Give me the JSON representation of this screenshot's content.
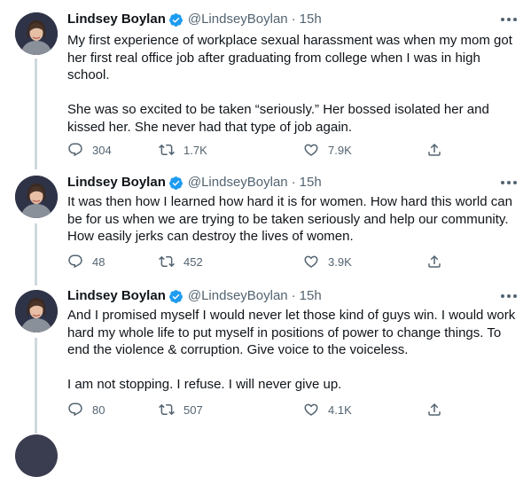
{
  "author": {
    "name": "Lindsey Boylan",
    "handle": "@LindseyBoylan",
    "separator": "·"
  },
  "colors": {
    "verified": "#1d9bf0",
    "text": "#0f1419",
    "muted": "#536471",
    "thread_line": "#cfd9de"
  },
  "tweets": [
    {
      "time": "15h",
      "paragraphs": [
        "My first experience of workplace sexual harassment was when my mom got her first real office job after graduating from college when I was in high school.",
        "She was so excited to be taken “seriously.” Her bossed isolated her and kissed her. She never had that type of job again."
      ],
      "replies": "304",
      "retweets": "1.7K",
      "likes": "7.9K"
    },
    {
      "time": "15h",
      "paragraphs": [
        "It was then how I learned how hard it is for women. How hard this world can be for us when we are trying to be taken seriously and help our community. How easily jerks can destroy the lives of women."
      ],
      "replies": "48",
      "retweets": "452",
      "likes": "3.9K"
    },
    {
      "time": "15h",
      "paragraphs": [
        "And I promised myself I would never let those kind of guys win. I would work hard my whole life to put myself in positions of power to change things. To end the violence & corruption. Give voice to the voiceless.",
        "I am not stopping. I refuse. I will never give up."
      ],
      "replies": "80",
      "retweets": "507",
      "likes": "4.1K"
    }
  ],
  "icons": {
    "reply": "reply-icon",
    "retweet": "retweet-icon",
    "like": "heart-icon",
    "share": "share-icon",
    "verified": "verified-badge-icon",
    "more": "more-icon"
  }
}
